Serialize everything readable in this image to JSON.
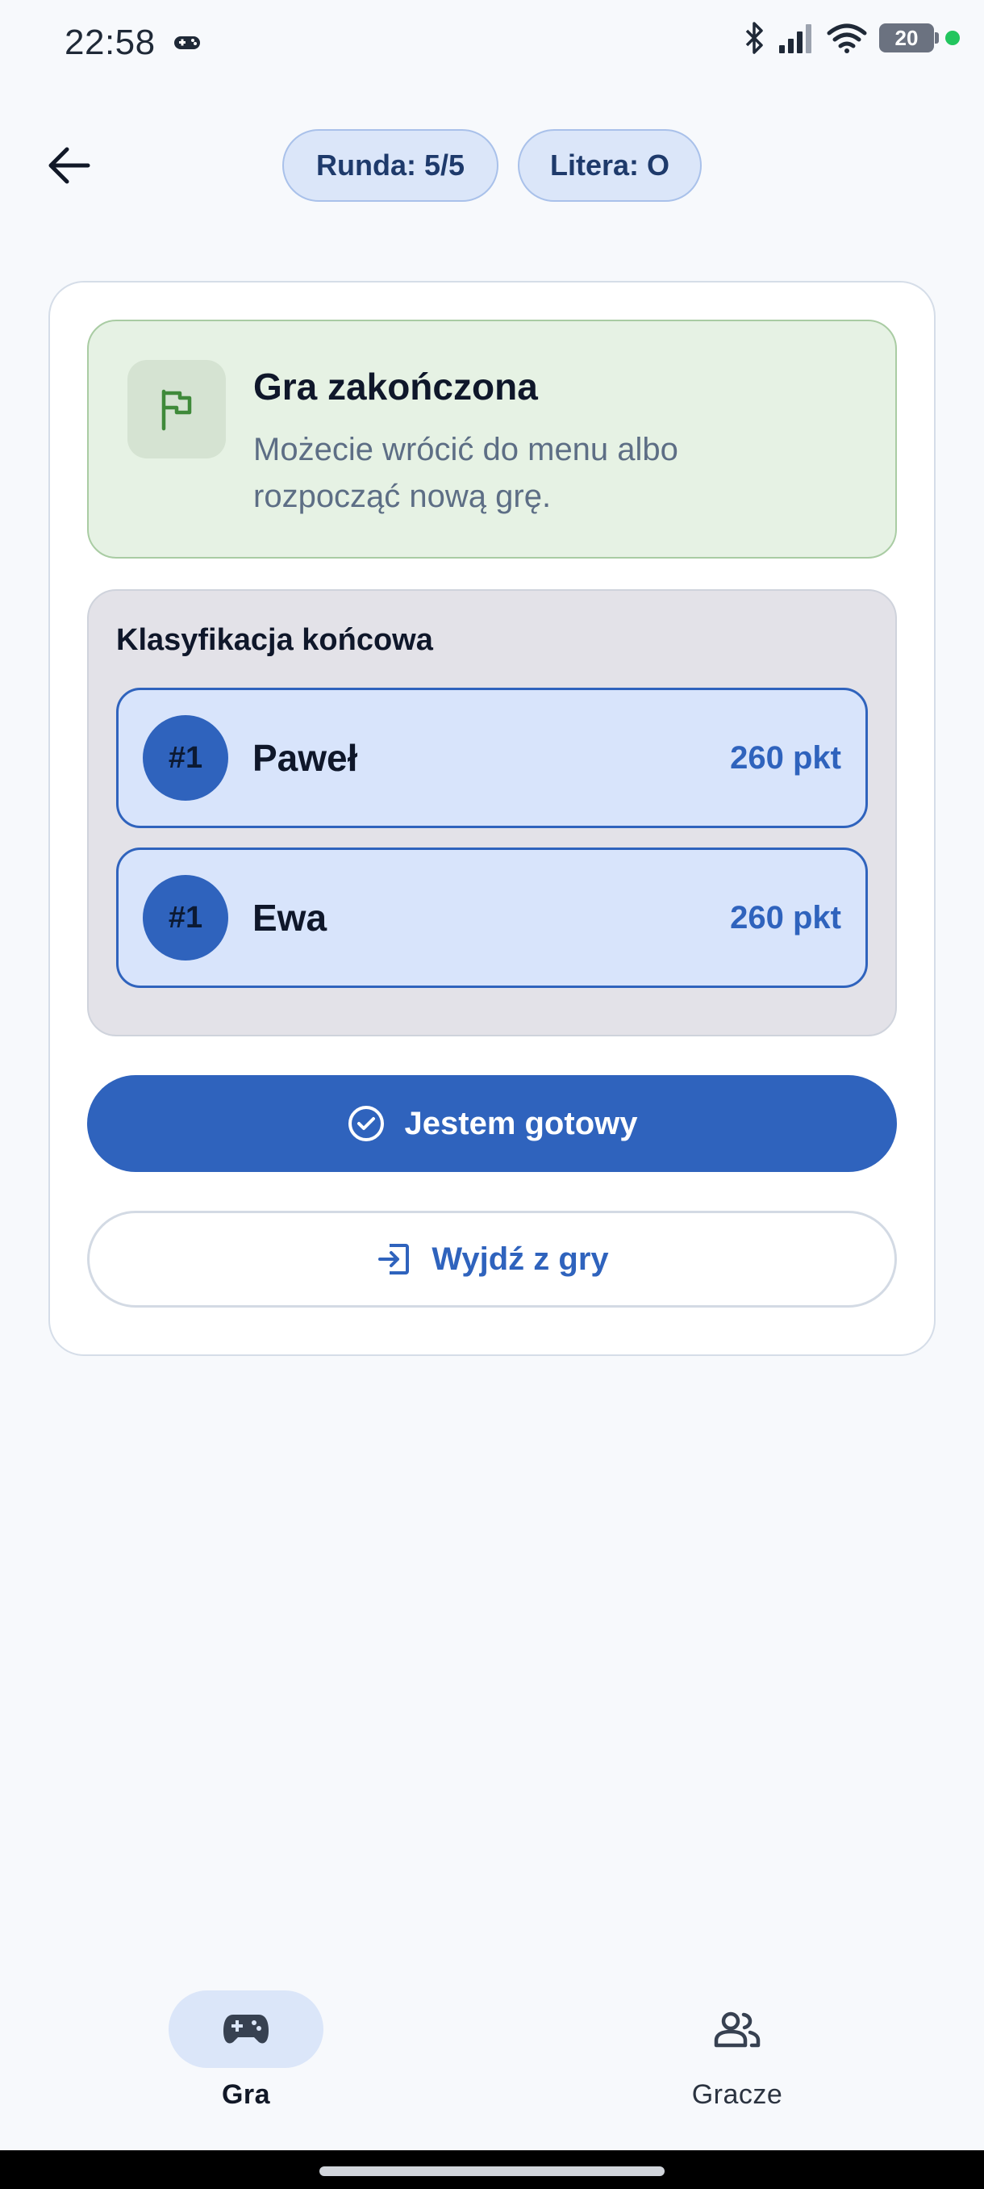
{
  "status_bar": {
    "time": "22:58",
    "battery": "20",
    "icons": [
      "gamepad-icon",
      "bluetooth-icon",
      "signal-icon",
      "wifi-icon",
      "battery-icon"
    ],
    "dot_color": "#22c55e"
  },
  "header": {
    "round_label": "Runda: 5/5",
    "letter_label": "Litera: O"
  },
  "finished": {
    "title": "Gra zakończona",
    "subtitle": "Możecie wrócić do menu albo rozpocząć nową grę."
  },
  "ranking": {
    "title": "Klasyfikacja końcowa",
    "players": [
      {
        "rank": "#1",
        "name": "Paweł",
        "score": "260 pkt"
      },
      {
        "rank": "#1",
        "name": "Ewa",
        "score": "260 pkt"
      }
    ]
  },
  "actions": {
    "ready_label": "Jestem gotowy",
    "exit_label": "Wyjdź z gry"
  },
  "bottom_nav": {
    "items": [
      {
        "label": "Gra",
        "icon": "gamepad-icon",
        "active": true
      },
      {
        "label": "Gracze",
        "icon": "people-icon",
        "active": false
      }
    ]
  },
  "colors": {
    "primary": "#2f63bd",
    "success_bg": "#e6f2e4",
    "flag": "#3f8a3a"
  }
}
